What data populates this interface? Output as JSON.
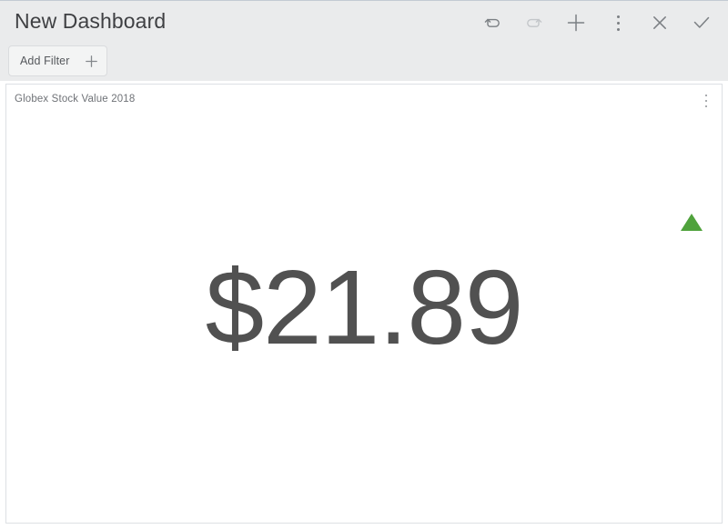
{
  "window": {
    "background_color": "#ffffff"
  },
  "toolbar": {
    "title": "New Dashboard",
    "actions": [
      {
        "name": "undo",
        "icon": "undo-icon",
        "label": "Undo",
        "enabled": true
      },
      {
        "name": "redo",
        "icon": "redo-icon",
        "label": "Redo",
        "enabled": false
      },
      {
        "name": "add",
        "icon": "plus-icon",
        "label": "Add",
        "enabled": true
      },
      {
        "name": "more",
        "icon": "kebab-menu-icon",
        "label": "More",
        "enabled": true
      },
      {
        "name": "close",
        "icon": "close-icon",
        "label": "Cancel",
        "enabled": true
      },
      {
        "name": "confirm",
        "icon": "checkmark-icon",
        "label": "Save",
        "enabled": true
      }
    ]
  },
  "filter_bar": {
    "add_filter_label": "Add Filter",
    "add_filter_icon": "plus-icon"
  },
  "panel": {
    "title": "Globex Stock Value 2018",
    "menu_icon": "kebab-menu-icon",
    "trend": {
      "direction": "up",
      "icon": "triangle-up-icon",
      "color": "#4fa23c"
    },
    "metric": {
      "value": "$21.89",
      "currency_symbol": "$",
      "amount": 21.89,
      "color": "#515151"
    }
  },
  "colors": {
    "toolbar_background": "#eaebec",
    "panel_background": "#ffffff",
    "panel_border": "#dde0e4",
    "title_text": "#3f4043",
    "panel_title_text": "#6f7277",
    "icon_enabled": "#7b7f83",
    "icon_disabled": "#c3c6c9",
    "trend_up": "#4fa23c",
    "metric_text": "#515151"
  }
}
